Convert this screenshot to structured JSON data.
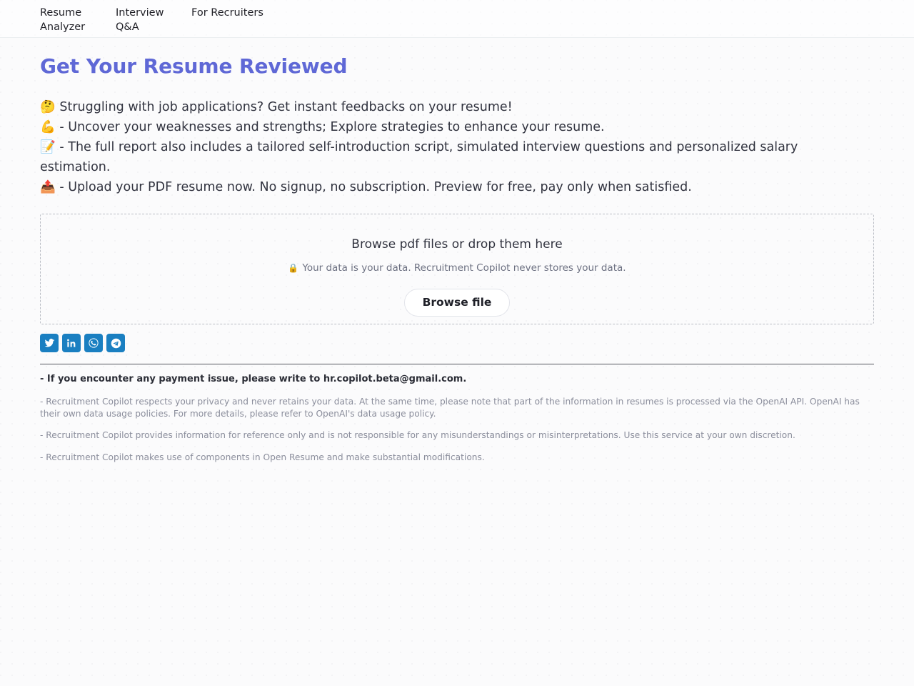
{
  "nav": {
    "items": [
      {
        "label": "Resume Analyzer",
        "name": "nav-resume-analyzer"
      },
      {
        "label": "Interview Q&A",
        "name": "nav-interview-qa"
      },
      {
        "label": "For Recruiters",
        "name": "nav-for-recruiters"
      }
    ]
  },
  "page": {
    "title": "Get Your Resume Reviewed",
    "title_color": "#5f68d6"
  },
  "intro": {
    "lines": [
      {
        "emoji": "🤔",
        "emoji_name": "thinking-face-icon",
        "text": "Struggling with job applications? Get instant feedbacks on your resume!"
      },
      {
        "emoji": "💪",
        "emoji_name": "flexed-biceps-icon",
        "text": "- Uncover your weaknesses and strengths; Explore strategies to enhance your resume."
      },
      {
        "emoji": "📝",
        "emoji_name": "memo-icon",
        "text": "- The full report also includes a tailored self-introduction script, simulated interview questions and personalized salary estimation."
      },
      {
        "emoji": "📤",
        "emoji_name": "outbox-tray-icon",
        "text": "- Upload your PDF resume now. No signup, no subscription. Preview for free, pay only when satisfied."
      }
    ]
  },
  "dropzone": {
    "title": "Browse pdf files or drop them here",
    "lock_icon": "🔒",
    "privacy_note": "Your data is your data. Recruitment Copilot never stores your data.",
    "browse_label": "Browse file"
  },
  "socials": {
    "color": "#1a7fc1",
    "items": [
      {
        "name": "twitter-share-icon",
        "label": "Twitter"
      },
      {
        "name": "linkedin-share-icon",
        "label": "LinkedIn"
      },
      {
        "name": "whatsapp-share-icon",
        "label": "WhatsApp"
      },
      {
        "name": "telegram-share-icon",
        "label": "Telegram"
      }
    ]
  },
  "footer": {
    "payment_notice": "- If you encounter any payment issue, please write to hr.copilot.beta@gmail.com.",
    "notes": [
      "- Recruitment Copilot respects your privacy and never retains your data. At the same time, please note that part of the information in resumes is processed via the OpenAI API. OpenAI has their own data usage policies. For more details, please refer to OpenAI's data usage policy.",
      "- Recruitment Copilot provides information for reference only and is not responsible for any misunderstandings or misinterpretations. Use this service at your own discretion.",
      "- Recruitment Copilot makes use of components in Open Resume and make substantial modifications."
    ]
  }
}
